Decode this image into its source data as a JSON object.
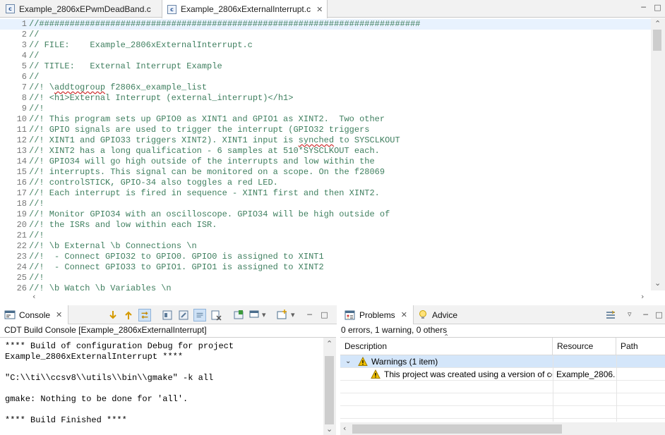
{
  "editor_tabs": [
    {
      "label": "Example_2806xEPwmDeadBand.c",
      "active": false,
      "icon": "c-source-file-icon"
    },
    {
      "label": "Example_2806xExternalInterrupt.c",
      "active": true,
      "icon": "c-source-file-icon",
      "close": "✕"
    }
  ],
  "editor": {
    "lines": [
      {
        "n": "1",
        "pre": "//###########################################################################"
      },
      {
        "n": "2",
        "pre": "//"
      },
      {
        "n": "3",
        "pre": "// FILE:    Example_2806xExternalInterrupt.c"
      },
      {
        "n": "4",
        "pre": "//"
      },
      {
        "n": "5",
        "pre": "// TITLE:   External Interrupt Example"
      },
      {
        "n": "6",
        "pre": "//"
      },
      {
        "n": "7",
        "pre": "//! \\",
        "spell": "addtogroup",
        "post": " f2806x_example_list"
      },
      {
        "n": "8",
        "pre": "//! <h1>External Interrupt (external_interrupt)</h1>"
      },
      {
        "n": "9",
        "pre": "//!"
      },
      {
        "n": "10",
        "pre": "//! This program sets up GPIO0 as XINT1 and GPIO1 as XINT2.  Two other"
      },
      {
        "n": "11",
        "pre": "//! GPIO signals are used to trigger the interrupt (GPIO32 triggers"
      },
      {
        "n": "12",
        "pre": "//! XINT1 and GPIO33 triggers XINT2). XINT1 input is ",
        "spell": "synched",
        "post": " to SYSCLKOUT"
      },
      {
        "n": "13",
        "pre": "//! XINT2 has a long qualification - 6 samples at 510*SYSCLKOUT each."
      },
      {
        "n": "14",
        "pre": "//! GPIO34 will go high outside of the interrupts and low within the"
      },
      {
        "n": "15",
        "pre": "//! interrupts. This signal can be monitored on a scope. On the f28069"
      },
      {
        "n": "16",
        "pre": "//! controlSTICK, GPIO-34 also toggles a red LED."
      },
      {
        "n": "17",
        "pre": "//! Each interrupt is fired in sequence - XINT1 first and then XINT2."
      },
      {
        "n": "18",
        "pre": "//!"
      },
      {
        "n": "19",
        "pre": "//! Monitor GPIO34 with an oscilloscope. GPIO34 will be high outside of"
      },
      {
        "n": "20",
        "pre": "//! the ISRs and low within each ISR."
      },
      {
        "n": "21",
        "pre": "//!"
      },
      {
        "n": "22",
        "pre": "//! \\b External \\b Connections \\n"
      },
      {
        "n": "23",
        "pre": "//!  - Connect GPIO32 to GPIO0. GPIO0 is assigned to XINT1"
      },
      {
        "n": "24",
        "pre": "//!  - Connect GPIO33 to GPIO1. GPIO1 is assigned to XINT2"
      },
      {
        "n": "25",
        "pre": "//!"
      },
      {
        "n": "26",
        "pre": "//! \\b Watch \\b Variables \\n"
      }
    ]
  },
  "console": {
    "tab_label": "Console",
    "subtitle": "CDT Build Console [Example_2806xExternalInterrupt]",
    "lines": [
      "**** Build of configuration Debug for project",
      "Example_2806xExternalInterrupt ****",
      "",
      "\"C:\\\\ti\\\\ccsv8\\\\utils\\\\bin\\\\gmake\" -k all",
      "",
      "gmake: Nothing to be done for 'all'.",
      "",
      "**** Build Finished ****"
    ]
  },
  "problems": {
    "tab_label": "Problems",
    "advice_label": "Advice",
    "summary": "0 errors, 1 warning, 0 others",
    "columns": [
      "Description",
      "Resource",
      "Path"
    ],
    "group": {
      "label": "Warnings (1 item)"
    },
    "rows": [
      {
        "description": "This project was created using a version of cc",
        "resource": "Example_2806...",
        "path": ""
      }
    ]
  },
  "colors": {
    "comment": "#3f7f5f",
    "line_number": "#787878",
    "current_line": "#e8f2fe",
    "selection": "#d4e6fa",
    "warning": "#f0c000"
  }
}
